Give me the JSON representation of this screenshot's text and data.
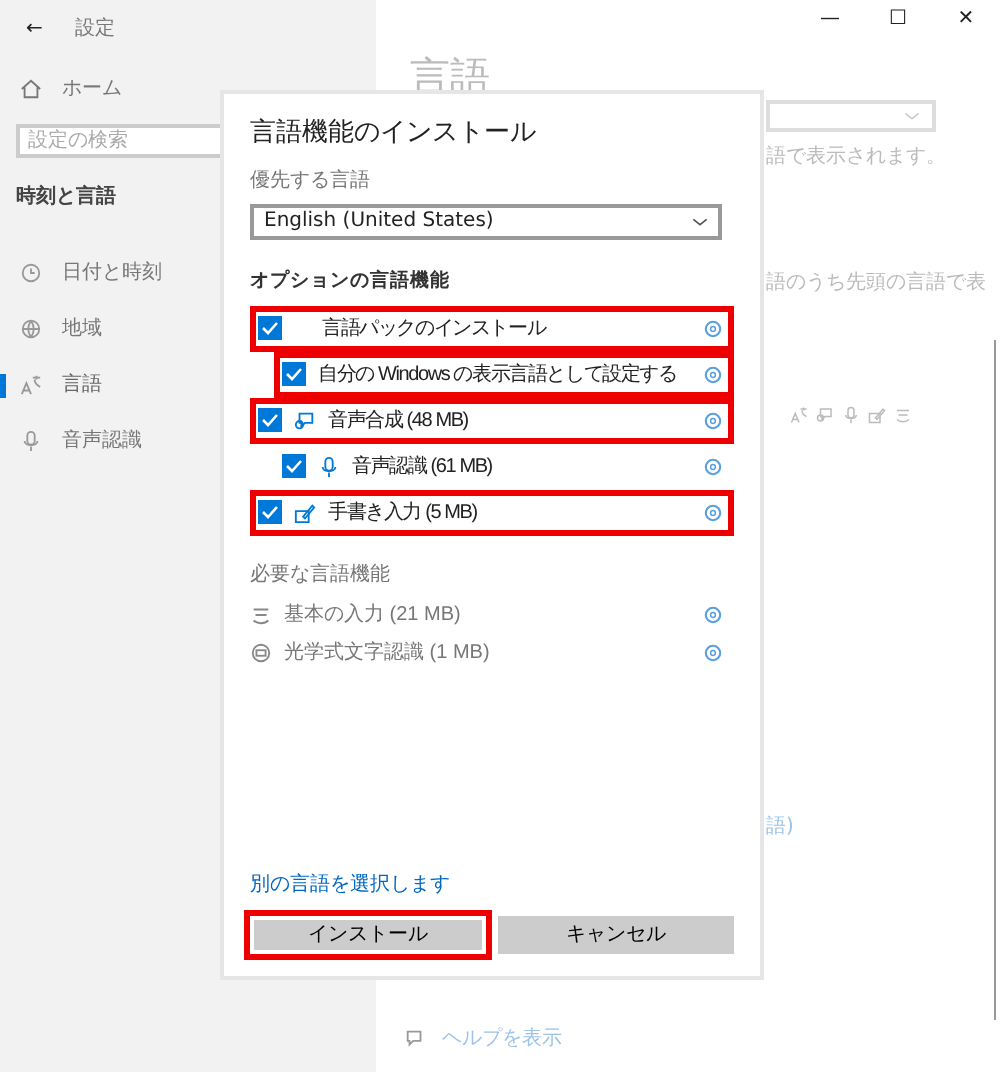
{
  "window": {
    "title": "設定",
    "back": "←",
    "controls": [
      "—",
      "☐",
      "✕"
    ]
  },
  "sidebar": {
    "home": "ホーム",
    "search": {
      "placeholder": "設定の検索"
    },
    "section": "時刻と言語",
    "items": [
      {
        "label": "日付と時刻",
        "kind": "clock",
        "selected": false
      },
      {
        "label": "地域",
        "kind": "globe",
        "selected": false
      },
      {
        "label": "言語",
        "kind": "lang",
        "selected": true
      },
      {
        "label": "音声認識",
        "kind": "mic",
        "selected": false
      }
    ]
  },
  "background": {
    "heading": "言語",
    "note_1": "語で表示されます。",
    "note_2": "語のうち先頭の言語で表",
    "link": "語)",
    "help": "ヘルプを表示"
  },
  "dialog": {
    "title": "言語機能のインストール",
    "preferred_label": "優先する言語",
    "preferred_value": "English (United States)",
    "options_label": "オプションの言語機能",
    "options": [
      {
        "label": "言語パックのインストール",
        "kind": "plain",
        "checked": true,
        "highlighted": true,
        "children": [
          {
            "label": "自分の Windows の表示言語として設定する",
            "kind": "plain",
            "checked": true,
            "highlighted": true
          }
        ]
      },
      {
        "label": "音声合成 (48 MB)",
        "kind": "speech",
        "checked": true,
        "highlighted": true,
        "children": [
          {
            "label": "音声認識 (61 MB)",
            "kind": "mic",
            "checked": true,
            "highlighted": false
          }
        ]
      },
      {
        "label": "手書き入力 (5 MB)",
        "kind": "handwriting",
        "checked": true,
        "highlighted": true
      }
    ],
    "required_label": "必要な言語機能",
    "required": [
      {
        "label": "基本の入力 (21 MB)",
        "kind": "typing"
      },
      {
        "label": "光学式文字認識 (1 MB)",
        "kind": "ocr"
      }
    ],
    "link": "別の言語を選択します",
    "buttons": [
      {
        "label": "インストール",
        "highlighted": true
      },
      {
        "label": "キャンセル",
        "highlighted": false
      }
    ]
  }
}
